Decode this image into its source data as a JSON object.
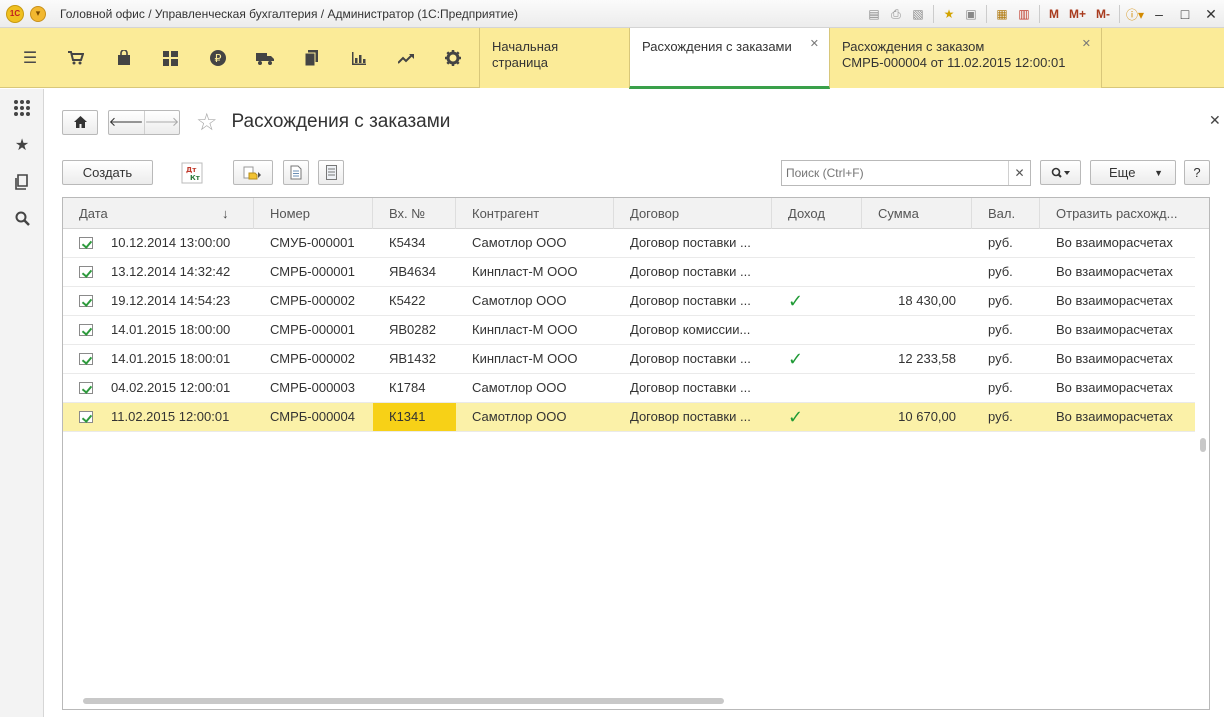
{
  "window": {
    "title": "Головной офис / Управленческая бухгалтерия / Администратор  (1С:Предприятие)",
    "logo_text": "1С",
    "mem_buttons": [
      "M",
      "M+",
      "M-"
    ]
  },
  "sections": [
    {
      "name": "main-menu",
      "icon": "☰"
    },
    {
      "name": "sales",
      "icon": "🛒"
    },
    {
      "name": "purchases",
      "icon": "👜"
    },
    {
      "name": "warehouse",
      "icon": "▦"
    },
    {
      "name": "finance",
      "icon": "₽"
    },
    {
      "name": "logistics",
      "icon": "🚚"
    },
    {
      "name": "documents",
      "icon": "❐"
    },
    {
      "name": "reports",
      "icon": "▮"
    },
    {
      "name": "analytics",
      "icon": "↗"
    },
    {
      "name": "settings",
      "icon": "⚙"
    }
  ],
  "tabs": {
    "home": "Начальная страница",
    "active": "Расхождения с заказами",
    "doc_line1": "Расхождения с заказом",
    "doc_line2": "СМРБ-000004 от 11.02.2015 12:00:01"
  },
  "page": {
    "title": "Расхождения с заказами"
  },
  "toolbar": {
    "create_label": "Создать",
    "search_placeholder": "Поиск (Ctrl+F)",
    "more_label": "Еще",
    "help_label": "?"
  },
  "table": {
    "columns": [
      "Дата",
      "Номер",
      "Вх. №",
      "Контрагент",
      "Договор",
      "Доход",
      "Сумма",
      "Вал.",
      "Отразить расхожд..."
    ],
    "rows": [
      {
        "date": "10.12.2014 13:00:00",
        "number": "СМУБ-000001",
        "in_no": "К5434",
        "counterparty": "Самотлор ООО",
        "contract": "Договор поставки ...",
        "income": false,
        "sum": "",
        "currency": "руб.",
        "reflect": "Во взаиморасчетах"
      },
      {
        "date": "13.12.2014 14:32:42",
        "number": "СМРБ-000001",
        "in_no": "ЯВ4634",
        "counterparty": "Кинпласт-М ООО",
        "contract": "Договор поставки ...",
        "income": false,
        "sum": "",
        "currency": "руб.",
        "reflect": "Во взаиморасчетах"
      },
      {
        "date": "19.12.2014 14:54:23",
        "number": "СМРБ-000002",
        "in_no": "К5422",
        "counterparty": "Самотлор ООО",
        "contract": "Договор поставки ...",
        "income": true,
        "sum": "18 430,00",
        "currency": "руб.",
        "reflect": "Во взаиморасчетах"
      },
      {
        "date": "14.01.2015 18:00:00",
        "number": "СМРБ-000001",
        "in_no": "ЯВ0282",
        "counterparty": "Кинпласт-М ООО",
        "contract": "Договор комиссии...",
        "income": false,
        "sum": "",
        "currency": "руб.",
        "reflect": "Во взаиморасчетах"
      },
      {
        "date": "14.01.2015 18:00:01",
        "number": "СМРБ-000002",
        "in_no": "ЯВ1432",
        "counterparty": "Кинпласт-М ООО",
        "contract": "Договор поставки ...",
        "income": true,
        "sum": "12 233,58",
        "currency": "руб.",
        "reflect": "Во взаиморасчетах"
      },
      {
        "date": "04.02.2015 12:00:01",
        "number": "СМРБ-000003",
        "in_no": "К1784",
        "counterparty": "Самотлор ООО",
        "contract": "Договор поставки ...",
        "income": false,
        "sum": "",
        "currency": "руб.",
        "reflect": "Во взаиморасчетах"
      },
      {
        "date": "11.02.2015 12:00:01",
        "number": "СМРБ-000004",
        "in_no": "К1341",
        "counterparty": "Самотлор ООО",
        "contract": "Договор поставки ...",
        "income": true,
        "sum": "10 670,00",
        "currency": "руб.",
        "reflect": "Во взаиморасчетах",
        "selected": true
      }
    ],
    "check_glyph": "✓",
    "sort_indicator": "↓"
  }
}
